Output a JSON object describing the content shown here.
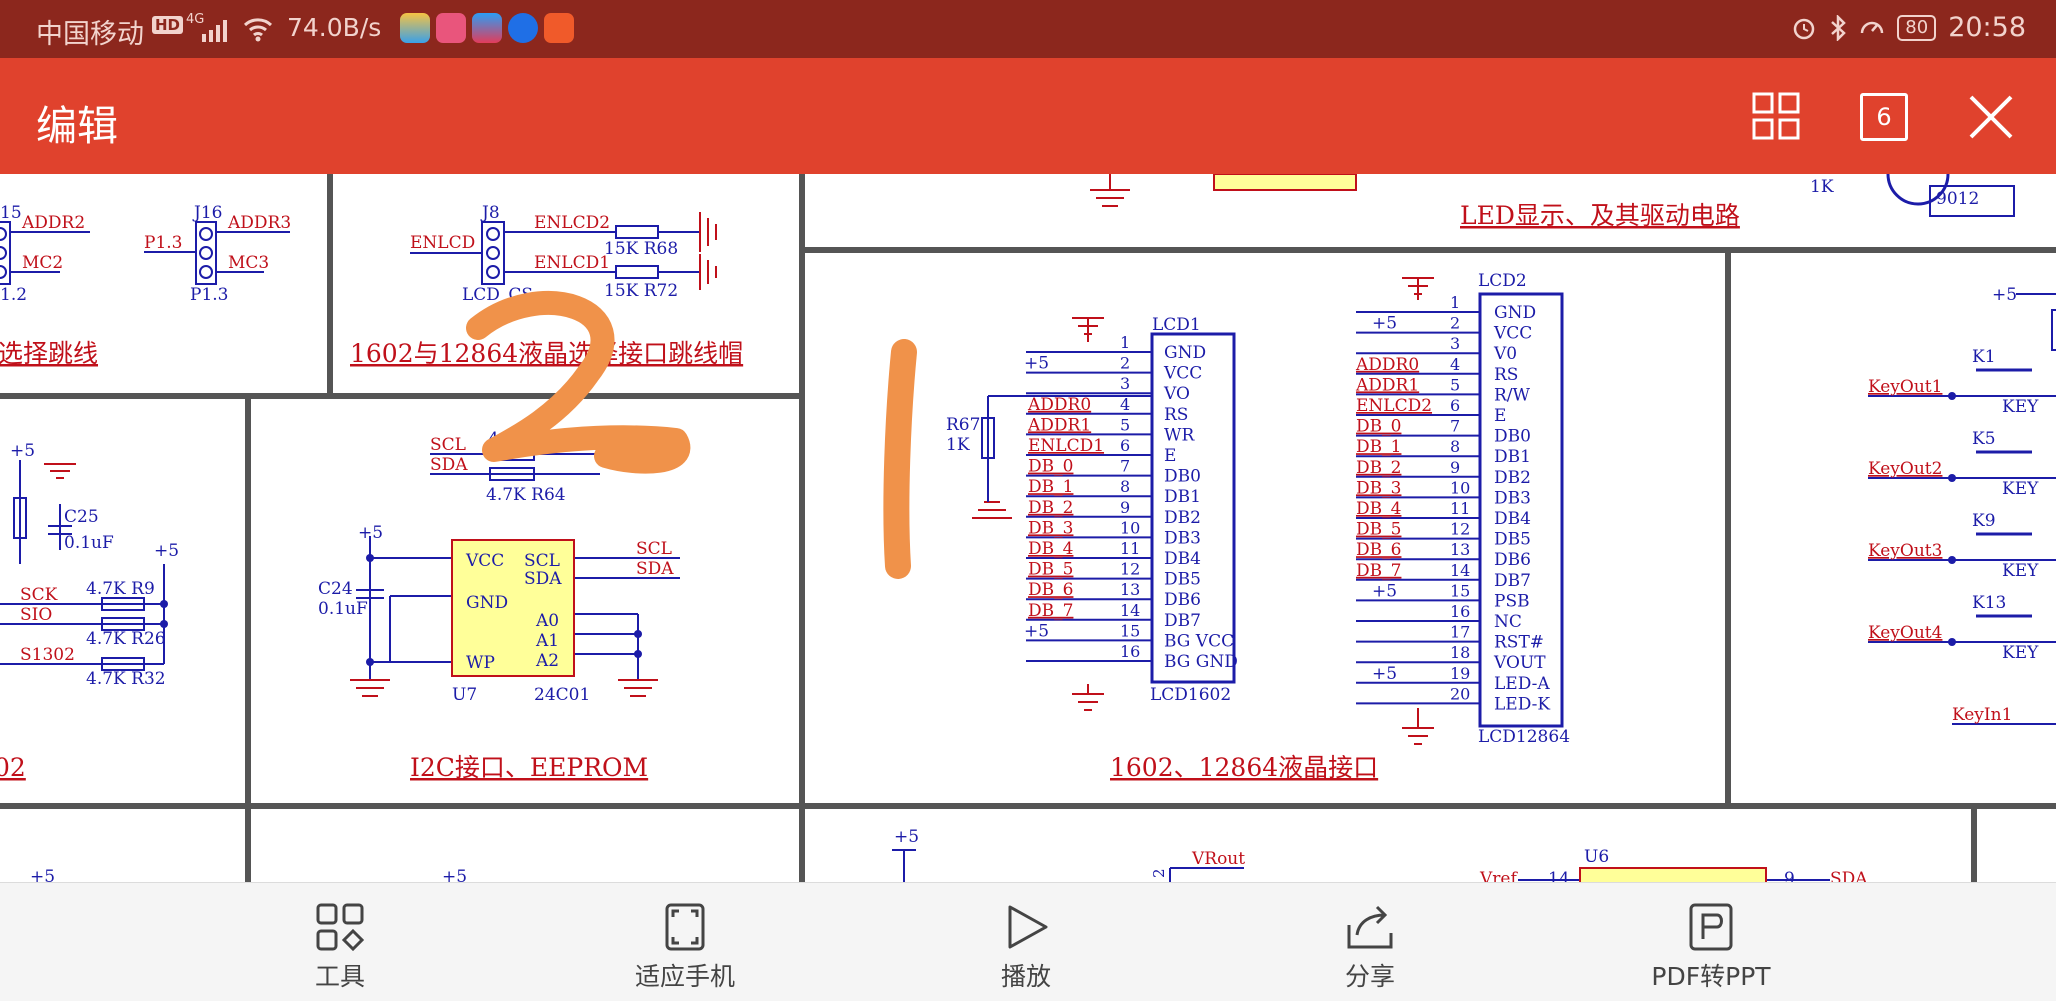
{
  "status_bar": {
    "carrier": "中国移动",
    "hd_badge": "HD",
    "network": "4G",
    "speed": "74.0B/s",
    "battery": "80",
    "time": "20:58",
    "icons": [
      "signal-icon",
      "wifi-icon",
      "app-icon",
      "app-icon",
      "app-icon",
      "app-icon",
      "app-icon",
      "alarm-icon",
      "bluetooth-icon",
      "speed-icon",
      "battery-icon"
    ]
  },
  "app_bar": {
    "title": "编辑",
    "page_count": "6",
    "icons": [
      "grid-view-icon",
      "page-count-icon",
      "close-icon"
    ]
  },
  "document": {
    "top_led_title": "LED显示、及其驱动电路",
    "transistor": "9012",
    "r_1k": "1K",
    "jumper_title": "选择跳线",
    "j15_addr2": "ADDR2",
    "j15_mc2": "MC2",
    "j15_p": "1.2",
    "j15": "15",
    "j16": "J16",
    "j16_addr3": "ADDR3",
    "j16_mc3": "MC3",
    "j16_p13a": "P1.3",
    "j16_p13b": "P1.3",
    "j8": "J8",
    "enlcd": "ENLCD",
    "enlcd2": "ENLCD2",
    "enlcd1": "ENLCD1",
    "r68": "15K  R68",
    "r72": "15K  R72",
    "lcd_cs": "LCD_CS",
    "jumper_cap_title": "1602与12864液晶选择接口跳线帽",
    "scl": "SCL",
    "sda": "SDA",
    "r_47_top": "4.7",
    "r64": "4.7K R64",
    "plus5": "+5",
    "u7_vcc": "VCC",
    "u7_gnd": "GND",
    "u7_wp": "WP",
    "u7_scl": "SCL",
    "u7_sda": "SDA",
    "u7_a0": "A0",
    "u7_a1": "A1",
    "u7_a2": "A2",
    "u7_name": "U7",
    "u7_part": "24C01",
    "c24": "C24",
    "c24_val": "0.1uF",
    "i2c_title": "I2C接口、EEPROM",
    "c25": "C25",
    "c25_val": "0.1uF",
    "sck": "SCK",
    "sio": "SIO",
    "s1302": "S1302",
    "r9": "4.7K R9",
    "r26": "4.7K R26",
    "r32": "4.7K R32",
    "left_bottom_title": "02",
    "r67": "R67",
    "r67_val": "1K",
    "lcd1": "LCD1",
    "lcd1602": "LCD1602",
    "lcd1_nets": [
      "",
      "+5",
      "",
      "ADDR0",
      "ADDR1",
      "ENLCD1",
      "DB_0",
      "DB_1",
      "DB_2",
      "DB_3",
      "DB_4",
      "DB_5",
      "DB_6",
      "DB_7",
      "+5",
      ""
    ],
    "lcd1_pins": [
      "GND",
      "VCC",
      "VO",
      "RS",
      "WR",
      "E",
      "DB0",
      "DB1",
      "DB2",
      "DB3",
      "DB4",
      "DB5",
      "DB6",
      "DB7",
      "BG VCC",
      "BG GND"
    ],
    "lcd2": "LCD2",
    "lcd12864": "LCD12864",
    "lcd2_nets": [
      "",
      "+5",
      "",
      "ADDR0",
      "ADDR1",
      "ENLCD2",
      "DB_0",
      "DB_1",
      "DB_2",
      "DB_3",
      "DB_4",
      "DB_5",
      "DB_6",
      "DB_7",
      "+5",
      "",
      "",
      "",
      "+5",
      ""
    ],
    "lcd2_pins": [
      "GND",
      "VCC",
      "V0",
      "RS",
      "R/W",
      "E",
      "DB0",
      "DB1",
      "DB2",
      "DB3",
      "DB4",
      "DB5",
      "DB6",
      "DB7",
      "PSB",
      "NC",
      "RST#",
      "VOUT",
      "LED-A",
      "LED-K"
    ],
    "lcd_title": "1602、12864液晶接口",
    "keys": [
      {
        "name": "K1",
        "out": "KeyOut1",
        "label": "KEY"
      },
      {
        "name": "K5",
        "out": "KeyOut2",
        "label": "KEY"
      },
      {
        "name": "K9",
        "out": "KeyOut3",
        "label": "KEY"
      },
      {
        "name": "K13",
        "out": "KeyOut4",
        "label": "KEY"
      }
    ],
    "keyin1": "KeyIn1",
    "vrout": "VRout",
    "vref": "Vref",
    "u6": "U6",
    "u6_pin14": "14",
    "u6_pin9": "9",
    "u6_sda": "SDA",
    "pin2": "2",
    "annotation_1": "1",
    "annotation_2": "2"
  },
  "toolbar": {
    "items": [
      {
        "label": "工具",
        "icon": "tools-icon"
      },
      {
        "label": "适应手机",
        "icon": "fit-screen-icon"
      },
      {
        "label": "播放",
        "icon": "play-icon"
      },
      {
        "label": "分享",
        "icon": "share-icon"
      },
      {
        "label": "PDF转PPT",
        "icon": "pdf-to-ppt-icon"
      }
    ]
  },
  "colors": {
    "status_bar": "#8c271d",
    "app_bar": "#e0422d",
    "schematic_blue": "#1c1ca8",
    "schematic_red": "#c0101a",
    "component_fill": "#ffff99",
    "annotation": "#f0924a"
  }
}
